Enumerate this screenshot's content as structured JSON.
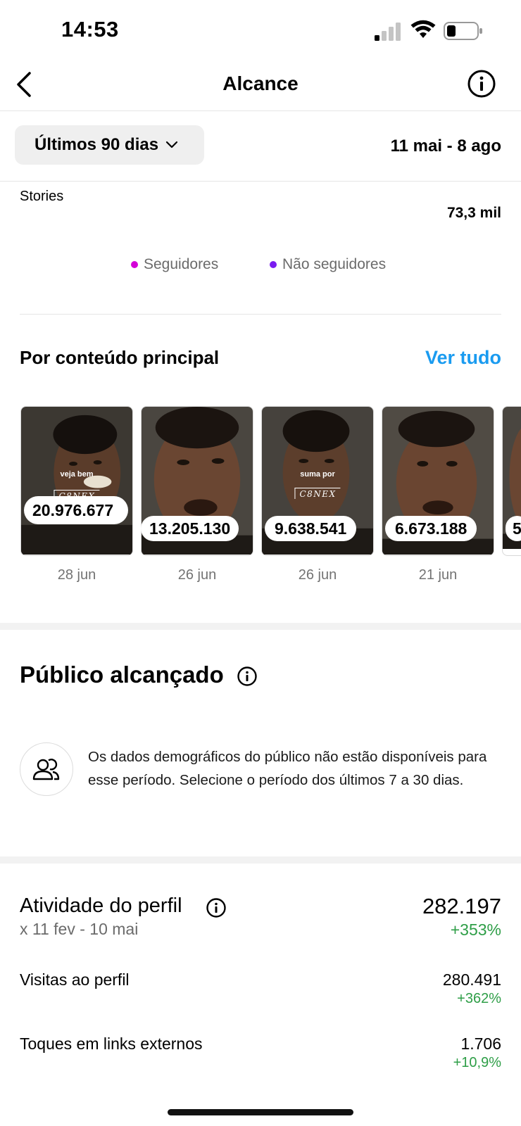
{
  "status_bar": {
    "time": "14:53"
  },
  "header": {
    "title": "Alcance"
  },
  "period": {
    "label": "Últimos 90 dias",
    "range": "11 mai - 8 ago"
  },
  "stories": {
    "label": "Stories",
    "value": "73,3 mil"
  },
  "legend": [
    {
      "label": "Seguidores",
      "color": "#d400d8"
    },
    {
      "label": "Não seguidores",
      "color": "#7a1bf0"
    }
  ],
  "top_content": {
    "title": "Por conteúdo principal",
    "see_all": "Ver tudo",
    "items": [
      {
        "value": "20.976.677",
        "date": "28 jun",
        "caption": "veja bem"
      },
      {
        "value": "13.205.130",
        "date": "26 jun",
        "caption": ""
      },
      {
        "value": "9.638.541",
        "date": "26 jun",
        "caption": "suma por"
      },
      {
        "value": "6.673.188",
        "date": "21 jun",
        "caption": ""
      },
      {
        "value": "5",
        "date": "",
        "caption": ""
      }
    ],
    "brand": "C8NEX"
  },
  "audience": {
    "title": "Público alcançado",
    "message": "Os dados demográficos do público não estão disponíveis para esse período. Selecione o período dos últimos 7 a 30 dias."
  },
  "activity": {
    "title": "Atividade do perfil",
    "comparison": "x 11 fev - 10 mai",
    "total": "282.197",
    "total_change": "+353%",
    "metrics": [
      {
        "label": "Visitas ao perfil",
        "value": "280.491",
        "change": "+362%"
      },
      {
        "label": "Toques em links externos",
        "value": "1.706",
        "change": "+10,9%"
      }
    ]
  }
}
